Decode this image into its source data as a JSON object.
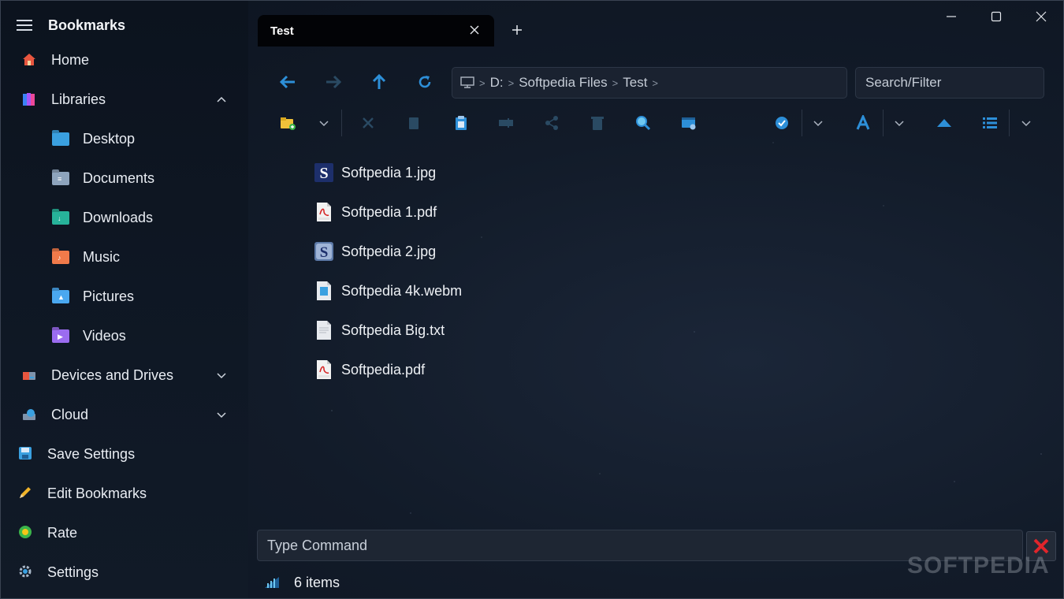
{
  "sidebar": {
    "title": "Bookmarks",
    "items": [
      {
        "label": "Home",
        "icon": "home-icon"
      },
      {
        "label": "Libraries",
        "icon": "libraries-icon"
      },
      {
        "label": "Desktop",
        "icon": "desktop-folder-icon"
      },
      {
        "label": "Documents",
        "icon": "documents-folder-icon"
      },
      {
        "label": "Downloads",
        "icon": "downloads-folder-icon"
      },
      {
        "label": "Music",
        "icon": "music-folder-icon"
      },
      {
        "label": "Pictures",
        "icon": "pictures-folder-icon"
      },
      {
        "label": "Videos",
        "icon": "videos-folder-icon"
      },
      {
        "label": "Devices and Drives",
        "icon": "drives-icon"
      },
      {
        "label": "Cloud",
        "icon": "cloud-icon"
      },
      {
        "label": "Save Settings",
        "icon": "save-icon"
      },
      {
        "label": "Edit Bookmarks",
        "icon": "pencil-icon"
      },
      {
        "label": "Rate",
        "icon": "rate-icon"
      },
      {
        "label": "Settings",
        "icon": "gear-icon"
      }
    ]
  },
  "tab": {
    "label": "Test"
  },
  "address": {
    "segments": [
      "D:",
      "Softpedia Files",
      "Test"
    ]
  },
  "search": {
    "placeholder": "Search/Filter"
  },
  "files": [
    {
      "name": "Softpedia 1.jpg",
      "type": "image-s"
    },
    {
      "name": "Softpedia 1.pdf",
      "type": "pdf"
    },
    {
      "name": "Softpedia 2.jpg",
      "type": "image-s2"
    },
    {
      "name": "Softpedia 4k.webm",
      "type": "video"
    },
    {
      "name": "Softpedia Big.txt",
      "type": "txt"
    },
    {
      "name": "Softpedia.pdf",
      "type": "pdf"
    }
  ],
  "command": {
    "placeholder": "Type Command"
  },
  "status": {
    "items": "6 items"
  },
  "watermark": "SOFTPEDIA",
  "colors": {
    "accent": "#2d8fd8",
    "toolbar_dim": "#2a4a63",
    "close_red": "#e0252b"
  }
}
